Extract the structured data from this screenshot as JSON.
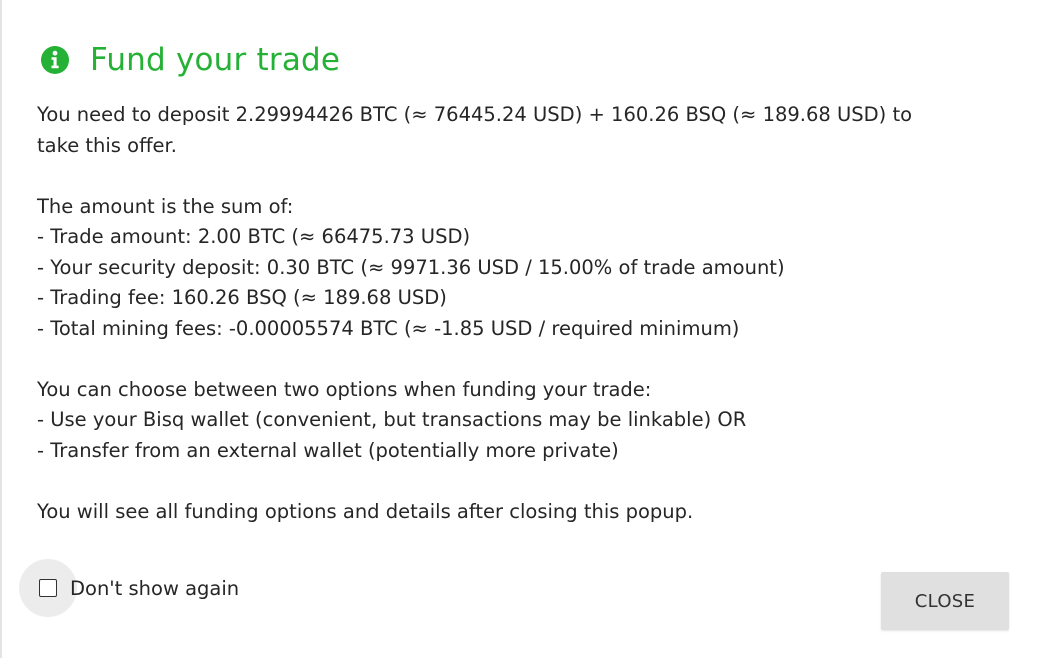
{
  "colors": {
    "title_green": "#25b135",
    "button_bg": "#e0e0e0",
    "text": "#262626"
  },
  "header": {
    "icon": "info-circle-icon",
    "title": "Fund your trade"
  },
  "message": {
    "deposit_lines": [
      "You need to deposit 2.29994426 BTC (≈ 76445.24 USD) + 160.26 BSQ (≈ 189.68 USD) to",
      "take this offer."
    ],
    "sum_intro": "The amount is the sum of:",
    "sum_items": [
      "- Trade amount: 2.00 BTC (≈ 66475.73 USD)",
      "- Your security deposit: 0.30 BTC (≈ 9971.36 USD / 15.00% of trade amount)",
      "- Trading fee: 160.26 BSQ (≈ 189.68 USD)",
      "- Total mining fees: -0.00005574 BTC (≈ -1.85 USD / required minimum)"
    ],
    "options_intro": "You can choose between two options when funding your trade:",
    "options_items": [
      "- Use your Bisq wallet (convenient, but transactions may be linkable) OR",
      "- Transfer from an external wallet (potentially more private)"
    ],
    "closing": "You will see all funding options and details after closing this popup."
  },
  "footer": {
    "dont_show_label": "Don't show again",
    "dont_show_checked": false,
    "close_label": "CLOSE"
  }
}
